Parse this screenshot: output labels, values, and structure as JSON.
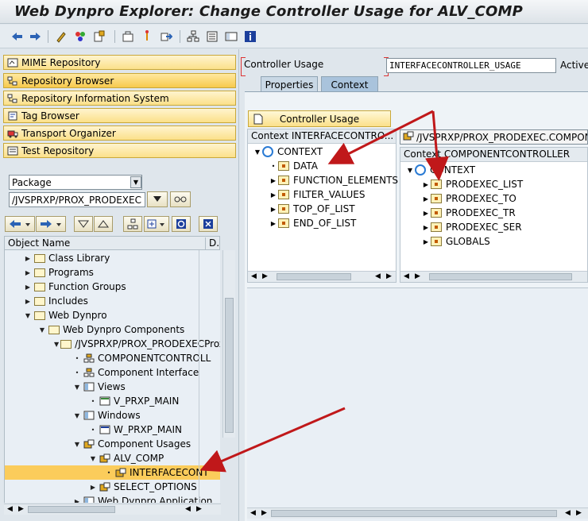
{
  "window": {
    "title": "Web Dynpro Explorer: Change Controller Usage for ALV_COMP"
  },
  "toolbar": {
    "icons": [
      "back-icon",
      "forward-icon",
      "edit-icon",
      "check-icon",
      "activate-icon",
      "test-icon",
      "where-used-icon",
      "navigate-icon",
      "object-list-icon",
      "display-list-icon",
      "info-icon"
    ]
  },
  "nav": {
    "items": [
      {
        "label": "MIME Repository"
      },
      {
        "label": "Repository Browser"
      },
      {
        "label": "Repository Information System"
      },
      {
        "label": "Tag Browser"
      },
      {
        "label": "Transport Organizer"
      },
      {
        "label": "Test Repository"
      }
    ]
  },
  "selector": {
    "object_type": "Package",
    "object_name": "/JVSPRXP/PROX_PRODEXEC"
  },
  "tree": {
    "col_name": "Object Name",
    "col_desc": "D.",
    "rows": [
      {
        "label": "Class Library",
        "level": 1
      },
      {
        "label": "Programs",
        "level": 1
      },
      {
        "label": "Function Groups",
        "level": 1
      },
      {
        "label": "Includes",
        "level": 1
      },
      {
        "label": "Web Dynpro",
        "level": 1
      },
      {
        "label": "Web Dynpro Components",
        "level": 2
      },
      {
        "label": "/JVSPRXP/PROX_PRODEXECProx",
        "level": 3
      },
      {
        "label": "COMPONENTCONTROLL",
        "level": 4
      },
      {
        "label": "Component Interface",
        "level": 4
      },
      {
        "label": "Views",
        "level": 4
      },
      {
        "label": "V_PRXP_MAIN",
        "level": 5
      },
      {
        "label": "Windows",
        "level": 4
      },
      {
        "label": "W_PRXP_MAIN",
        "level": 5
      },
      {
        "label": "Component Usages",
        "level": 4
      },
      {
        "label": "ALV_COMP",
        "level": 5
      },
      {
        "label": "INTERFACECONT",
        "level": 6
      },
      {
        "label": "SELECT_OPTIONS",
        "level": 5
      },
      {
        "label": "Web Dynpro Application",
        "level": 4
      }
    ]
  },
  "header_fields": {
    "controller_usage_label": "Controller Usage",
    "controller_usage_value": "INTERFACECONTROLLER_USAGE",
    "status": "Active"
  },
  "tabs": [
    {
      "label": "Properties"
    },
    {
      "label": "Context"
    }
  ],
  "controller_usage_button": "Controller Usage",
  "left_context": {
    "header": "Context INTERFACECONTRO...",
    "root": "CONTEXT",
    "nodes": [
      "DATA",
      "FUNCTION_ELEMENTS",
      "FILTER_VALUES",
      "TOP_OF_LIST",
      "END_OF_LIST"
    ]
  },
  "right_context": {
    "component": "/JVSPRXP/PROX_PRODEXEC.COMPONEN",
    "header": "Context COMPONENTCONTROLLER",
    "root": "CONTEXT",
    "nodes": [
      "PRODEXEC_LIST",
      "PRODEXEC_TO",
      "PRODEXEC_TR",
      "PRODEXEC_SER",
      "GLOBALS"
    ]
  },
  "colors": {
    "nav_button": "#fbe08a",
    "highlight_row": "#fbcc5b",
    "arrow": "#c0181a",
    "context_circle": "#2a7bd4"
  }
}
